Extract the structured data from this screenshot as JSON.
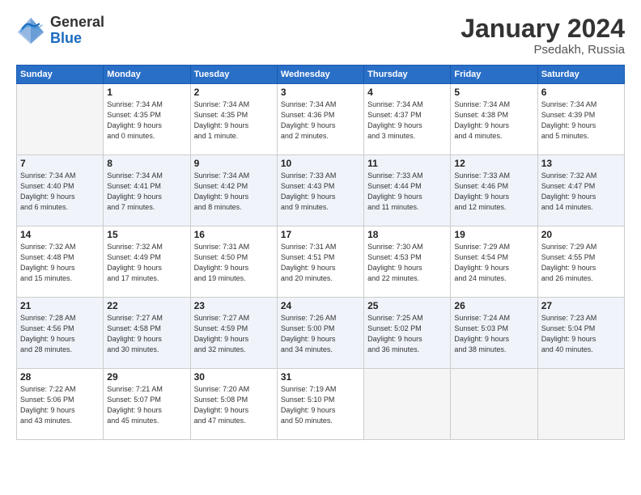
{
  "header": {
    "logo_general": "General",
    "logo_blue": "Blue",
    "month_title": "January 2024",
    "location": "Psedakh, Russia"
  },
  "weekdays": [
    "Sunday",
    "Monday",
    "Tuesday",
    "Wednesday",
    "Thursday",
    "Friday",
    "Saturday"
  ],
  "weeks": [
    [
      {
        "day": "",
        "info": ""
      },
      {
        "day": "1",
        "info": "Sunrise: 7:34 AM\nSunset: 4:35 PM\nDaylight: 9 hours\nand 0 minutes."
      },
      {
        "day": "2",
        "info": "Sunrise: 7:34 AM\nSunset: 4:35 PM\nDaylight: 9 hours\nand 1 minute."
      },
      {
        "day": "3",
        "info": "Sunrise: 7:34 AM\nSunset: 4:36 PM\nDaylight: 9 hours\nand 2 minutes."
      },
      {
        "day": "4",
        "info": "Sunrise: 7:34 AM\nSunset: 4:37 PM\nDaylight: 9 hours\nand 3 minutes."
      },
      {
        "day": "5",
        "info": "Sunrise: 7:34 AM\nSunset: 4:38 PM\nDaylight: 9 hours\nand 4 minutes."
      },
      {
        "day": "6",
        "info": "Sunrise: 7:34 AM\nSunset: 4:39 PM\nDaylight: 9 hours\nand 5 minutes."
      }
    ],
    [
      {
        "day": "7",
        "info": "Sunrise: 7:34 AM\nSunset: 4:40 PM\nDaylight: 9 hours\nand 6 minutes."
      },
      {
        "day": "8",
        "info": "Sunrise: 7:34 AM\nSunset: 4:41 PM\nDaylight: 9 hours\nand 7 minutes."
      },
      {
        "day": "9",
        "info": "Sunrise: 7:34 AM\nSunset: 4:42 PM\nDaylight: 9 hours\nand 8 minutes."
      },
      {
        "day": "10",
        "info": "Sunrise: 7:33 AM\nSunset: 4:43 PM\nDaylight: 9 hours\nand 9 minutes."
      },
      {
        "day": "11",
        "info": "Sunrise: 7:33 AM\nSunset: 4:44 PM\nDaylight: 9 hours\nand 11 minutes."
      },
      {
        "day": "12",
        "info": "Sunrise: 7:33 AM\nSunset: 4:46 PM\nDaylight: 9 hours\nand 12 minutes."
      },
      {
        "day": "13",
        "info": "Sunrise: 7:32 AM\nSunset: 4:47 PM\nDaylight: 9 hours\nand 14 minutes."
      }
    ],
    [
      {
        "day": "14",
        "info": "Sunrise: 7:32 AM\nSunset: 4:48 PM\nDaylight: 9 hours\nand 15 minutes."
      },
      {
        "day": "15",
        "info": "Sunrise: 7:32 AM\nSunset: 4:49 PM\nDaylight: 9 hours\nand 17 minutes."
      },
      {
        "day": "16",
        "info": "Sunrise: 7:31 AM\nSunset: 4:50 PM\nDaylight: 9 hours\nand 19 minutes."
      },
      {
        "day": "17",
        "info": "Sunrise: 7:31 AM\nSunset: 4:51 PM\nDaylight: 9 hours\nand 20 minutes."
      },
      {
        "day": "18",
        "info": "Sunrise: 7:30 AM\nSunset: 4:53 PM\nDaylight: 9 hours\nand 22 minutes."
      },
      {
        "day": "19",
        "info": "Sunrise: 7:29 AM\nSunset: 4:54 PM\nDaylight: 9 hours\nand 24 minutes."
      },
      {
        "day": "20",
        "info": "Sunrise: 7:29 AM\nSunset: 4:55 PM\nDaylight: 9 hours\nand 26 minutes."
      }
    ],
    [
      {
        "day": "21",
        "info": "Sunrise: 7:28 AM\nSunset: 4:56 PM\nDaylight: 9 hours\nand 28 minutes."
      },
      {
        "day": "22",
        "info": "Sunrise: 7:27 AM\nSunset: 4:58 PM\nDaylight: 9 hours\nand 30 minutes."
      },
      {
        "day": "23",
        "info": "Sunrise: 7:27 AM\nSunset: 4:59 PM\nDaylight: 9 hours\nand 32 minutes."
      },
      {
        "day": "24",
        "info": "Sunrise: 7:26 AM\nSunset: 5:00 PM\nDaylight: 9 hours\nand 34 minutes."
      },
      {
        "day": "25",
        "info": "Sunrise: 7:25 AM\nSunset: 5:02 PM\nDaylight: 9 hours\nand 36 minutes."
      },
      {
        "day": "26",
        "info": "Sunrise: 7:24 AM\nSunset: 5:03 PM\nDaylight: 9 hours\nand 38 minutes."
      },
      {
        "day": "27",
        "info": "Sunrise: 7:23 AM\nSunset: 5:04 PM\nDaylight: 9 hours\nand 40 minutes."
      }
    ],
    [
      {
        "day": "28",
        "info": "Sunrise: 7:22 AM\nSunset: 5:06 PM\nDaylight: 9 hours\nand 43 minutes."
      },
      {
        "day": "29",
        "info": "Sunrise: 7:21 AM\nSunset: 5:07 PM\nDaylight: 9 hours\nand 45 minutes."
      },
      {
        "day": "30",
        "info": "Sunrise: 7:20 AM\nSunset: 5:08 PM\nDaylight: 9 hours\nand 47 minutes."
      },
      {
        "day": "31",
        "info": "Sunrise: 7:19 AM\nSunset: 5:10 PM\nDaylight: 9 hours\nand 50 minutes."
      },
      {
        "day": "",
        "info": ""
      },
      {
        "day": "",
        "info": ""
      },
      {
        "day": "",
        "info": ""
      }
    ]
  ]
}
